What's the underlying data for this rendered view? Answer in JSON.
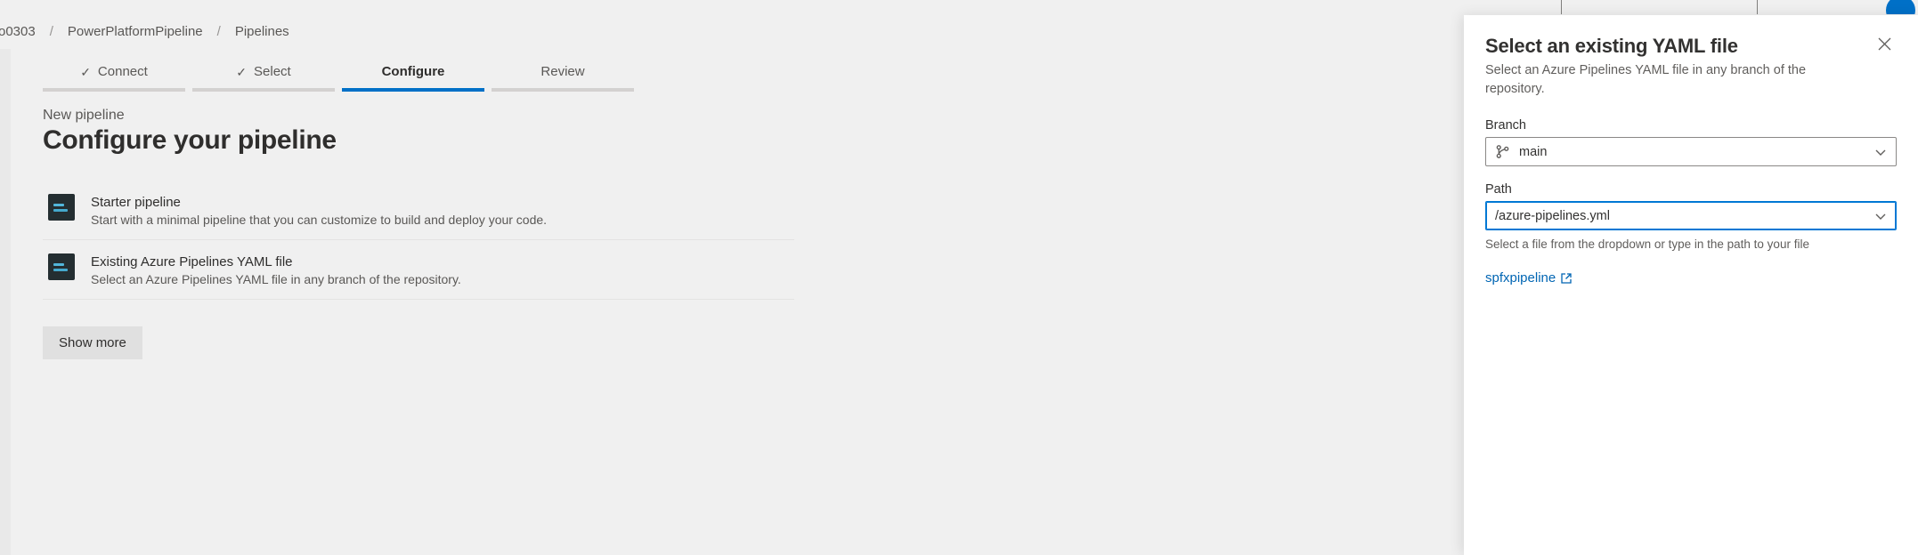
{
  "breadcrumb": {
    "first": "o0303",
    "second": "PowerPlatformPipeline",
    "third": "Pipelines"
  },
  "steps": {
    "connect": "Connect",
    "select": "Select",
    "configure": "Configure",
    "review": "Review"
  },
  "page": {
    "kicker": "New pipeline",
    "title": "Configure your pipeline"
  },
  "options": [
    {
      "title": "Starter pipeline",
      "sub": "Start with a minimal pipeline that you can customize to build and deploy your code."
    },
    {
      "title": "Existing Azure Pipelines YAML file",
      "sub": "Select an Azure Pipelines YAML file in any branch of the repository."
    }
  ],
  "show_more": "Show more",
  "panel": {
    "title": "Select an existing YAML file",
    "sub": "Select an Azure Pipelines YAML file in any branch of the repository.",
    "branch_label": "Branch",
    "branch_value": "main",
    "path_label": "Path",
    "path_value": "/azure-pipelines.yml",
    "hint": "Select a file from the dropdown or type in the path to your file",
    "link_text": "spfxpipeline"
  }
}
